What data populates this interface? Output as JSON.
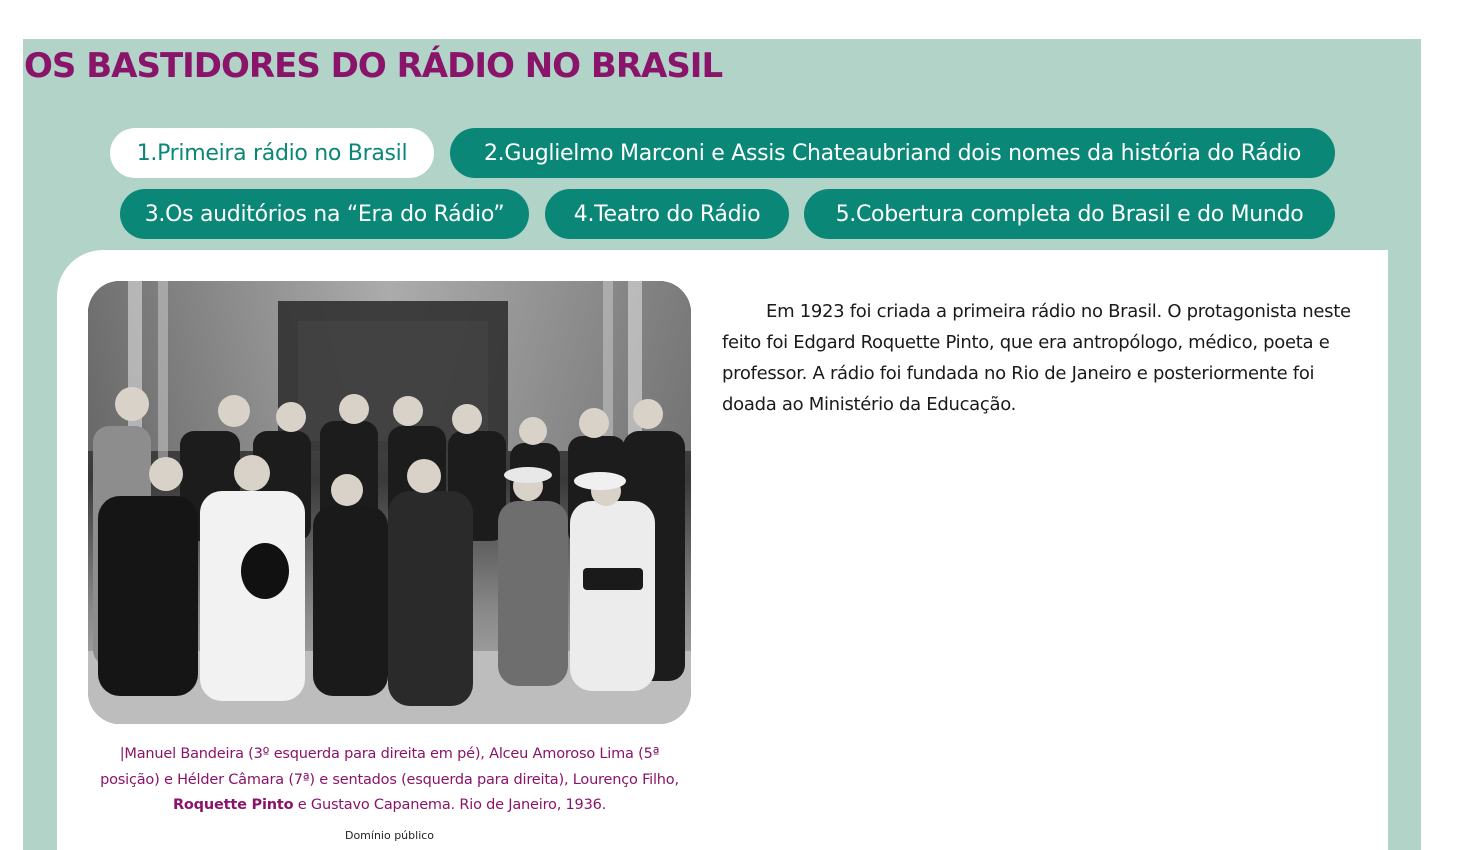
{
  "page": {
    "title": "OS BASTIDORES DO RÁDIO NO BRASIL"
  },
  "tabs": [
    {
      "label": "1.Primeira rádio no Brasil",
      "active": true
    },
    {
      "label": "2.Guglielmo Marconi e Assis Chateaubriand dois nomes da história do Rádio",
      "active": false
    },
    {
      "label": "3.Os auditórios na “Era do Rádio”",
      "active": false
    },
    {
      "label": "4.Teatro do Rádio",
      "active": false
    },
    {
      "label": "5.Cobertura completa do Brasil e do Mundo",
      "active": false
    }
  ],
  "content": {
    "photo_alt": "historic-group-photo",
    "caption": {
      "part1": "|Manuel Bandeira (3º esquerda para direita em pé), Alceu Amoroso Lima (5ª posição) e Hélder Câmara (7ª) e sentados (esquerda para direita), Lourenço Filho, ",
      "highlight": "Roquette Pinto",
      "part2": " e Gustavo Capanema. Rio de Janeiro, 1936."
    },
    "credit": "Domínio público",
    "paragraph": "Em 1923 foi criada a primeira rádio no Brasil. O protagonista neste feito foi Edgard Roquette Pinto, que era antropólogo, médico, poeta e professor. A rádio foi fundada no Rio de Janeiro e posteriormente foi doada ao Ministério da Educação."
  },
  "colors": {
    "panel": "#b1d3c8",
    "title": "#8a1469",
    "tab": "#0a8777",
    "tab_active_bg": "#ffffff"
  }
}
